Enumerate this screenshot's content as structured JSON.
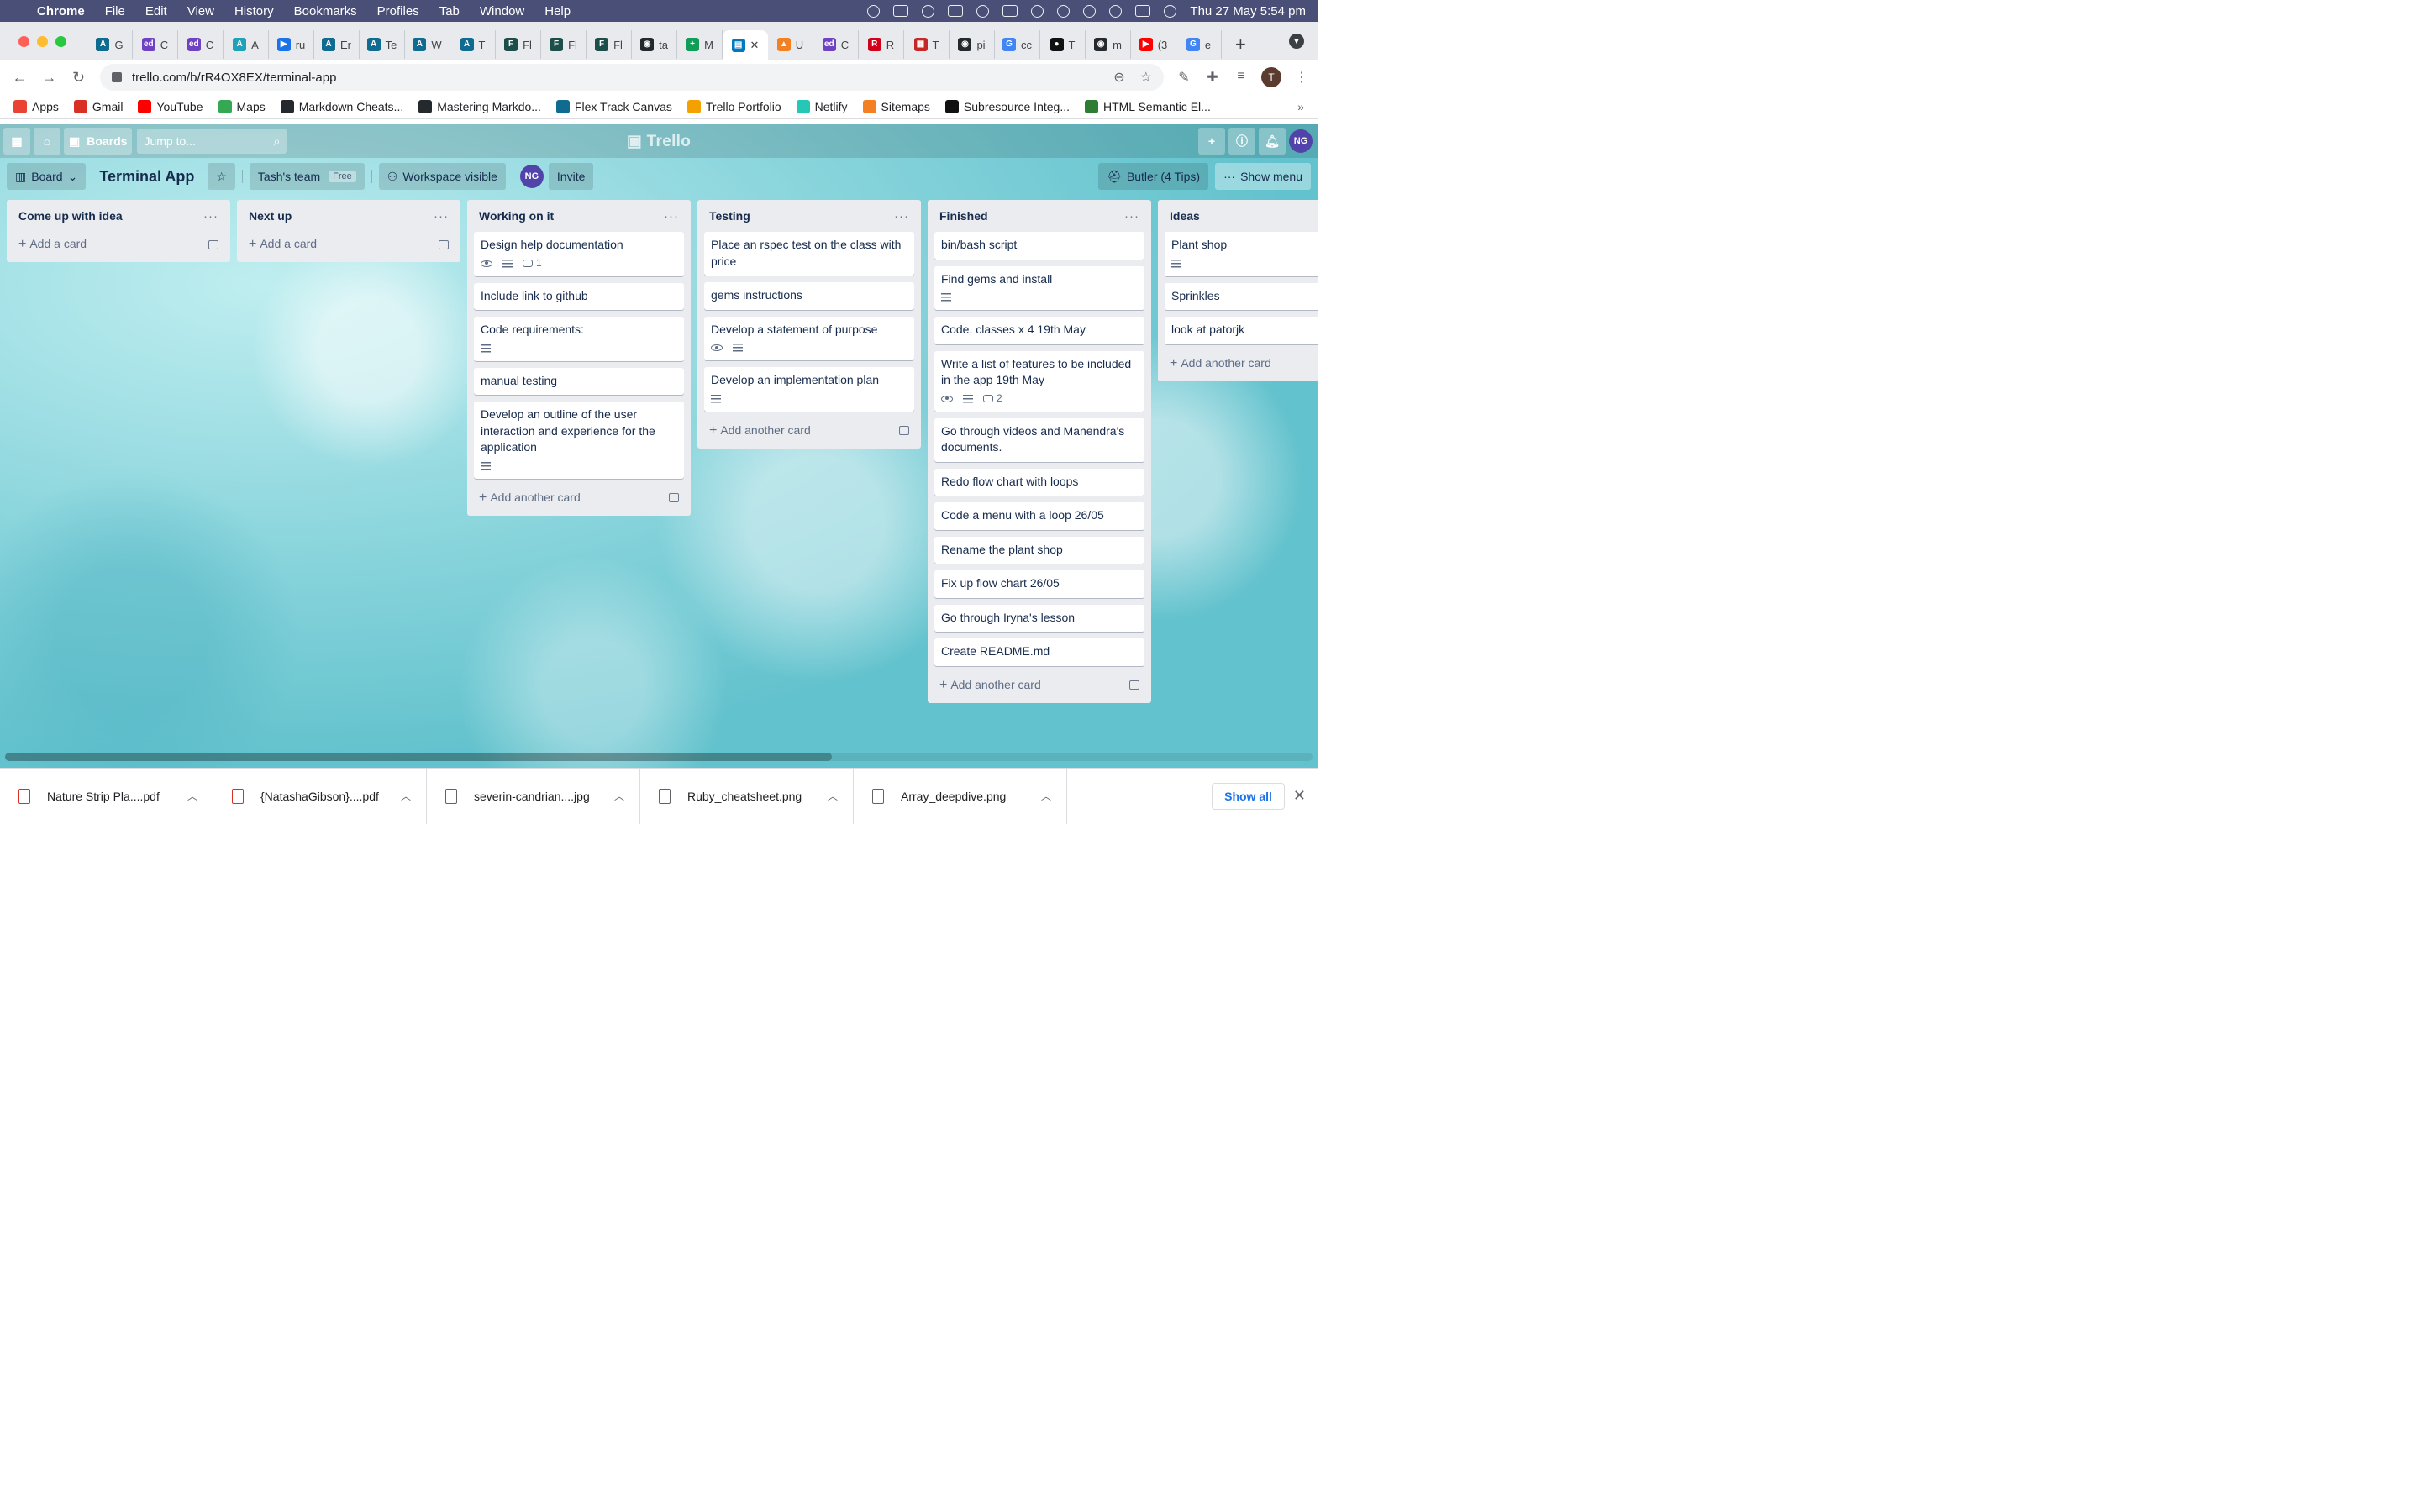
{
  "menubar": {
    "app": "Chrome",
    "items": [
      "File",
      "Edit",
      "View",
      "History",
      "Bookmarks",
      "Profiles",
      "Tab",
      "Window",
      "Help"
    ],
    "clock": "Thu 27 May  5:54 pm"
  },
  "tabs": [
    {
      "fav": "A",
      "label": "G",
      "color": "#0f6b8f"
    },
    {
      "fav": "ed",
      "label": "C",
      "color": "#6f42c1"
    },
    {
      "fav": "ed",
      "label": "C",
      "color": "#6f42c1"
    },
    {
      "fav": "A",
      "label": "A",
      "color": "#21a1b8"
    },
    {
      "fav": "▶",
      "label": "ru",
      "color": "#1a73e8"
    },
    {
      "fav": "A",
      "label": "Er",
      "color": "#0f6b8f"
    },
    {
      "fav": "A",
      "label": "Te",
      "color": "#0f6b8f"
    },
    {
      "fav": "A",
      "label": "W",
      "color": "#0f6b8f"
    },
    {
      "fav": "A",
      "label": "T",
      "color": "#0f6b8f"
    },
    {
      "fav": "F",
      "label": "Fl",
      "color": "#1c4e4a"
    },
    {
      "fav": "F",
      "label": "Fl",
      "color": "#1c4e4a"
    },
    {
      "fav": "F",
      "label": "Fl",
      "color": "#1c4e4a"
    },
    {
      "fav": "◉",
      "label": "ta",
      "color": "#24292e"
    },
    {
      "fav": "+",
      "label": "M",
      "color": "#0f9d58"
    },
    {
      "fav": "▤",
      "label": "",
      "color": "#0079bf",
      "active": true
    },
    {
      "fav": "▲",
      "label": "U",
      "color": "#f48024"
    },
    {
      "fav": "ed",
      "label": "C",
      "color": "#6f42c1"
    },
    {
      "fav": "R",
      "label": "R",
      "color": "#d0021b"
    },
    {
      "fav": "▦",
      "label": "T",
      "color": "#c62828"
    },
    {
      "fav": "◉",
      "label": "pi",
      "color": "#24292e"
    },
    {
      "fav": "G",
      "label": "cc",
      "color": "#4285f4"
    },
    {
      "fav": "●",
      "label": "T",
      "color": "#111111"
    },
    {
      "fav": "◉",
      "label": "m",
      "color": "#24292e"
    },
    {
      "fav": "▶",
      "label": "(3",
      "color": "#ff0000"
    },
    {
      "fav": "G",
      "label": "e",
      "color": "#4285f4"
    }
  ],
  "omnibox": {
    "url": "trello.com/b/rR4OX8EX/terminal-app"
  },
  "bookmarks": [
    {
      "label": "Apps",
      "color": "#ea4335"
    },
    {
      "label": "Gmail",
      "color": "#d93025"
    },
    {
      "label": "YouTube",
      "color": "#ff0000"
    },
    {
      "label": "Maps",
      "color": "#34a853"
    },
    {
      "label": "Markdown Cheats...",
      "color": "#24292e"
    },
    {
      "label": "Mastering Markdo...",
      "color": "#24292e"
    },
    {
      "label": "Flex Track Canvas",
      "color": "#0f6b8f"
    },
    {
      "label": "Trello Portfolio",
      "color": "#f4a100"
    },
    {
      "label": "Netlify",
      "color": "#25c7b7"
    },
    {
      "label": "Sitemaps",
      "color": "#f48024"
    },
    {
      "label": "Subresource Integ...",
      "color": "#111111"
    },
    {
      "label": "HTML Semantic El...",
      "color": "#2e7d32"
    }
  ],
  "trello": {
    "boards_label": "Boards",
    "jump_placeholder": "Jump to...",
    "logo": "Trello",
    "user_initials": "NG"
  },
  "boardbar": {
    "view": "Board",
    "title": "Terminal App",
    "team": "Tash's team",
    "team_plan": "Free",
    "visibility": "Workspace visible",
    "invite": "Invite",
    "butler": "Butler (4 Tips)",
    "show_menu": "Show menu"
  },
  "lists": [
    {
      "title": "Come up with idea",
      "add": "Add a card",
      "cards": []
    },
    {
      "title": "Next up",
      "add": "Add a card",
      "cards": []
    },
    {
      "title": "Working on it",
      "add": "Add another card",
      "cards": [
        {
          "text": "Design help documentation",
          "watch": true,
          "desc": true,
          "comments": "1"
        },
        {
          "text": "Include link to github"
        },
        {
          "text": "Code requirements:",
          "desc": true
        },
        {
          "text": "manual testing"
        },
        {
          "text": "Develop an outline of the user interaction and experience for the application",
          "desc": true
        }
      ]
    },
    {
      "title": "Testing",
      "add": "Add another card",
      "cards": [
        {
          "text": "Place an rspec test on the class with price"
        },
        {
          "text": "gems instructions"
        },
        {
          "text": "Develop a statement of purpose",
          "watch": true,
          "desc": true
        },
        {
          "text": "Develop an implementation plan",
          "desc": true
        }
      ]
    },
    {
      "title": "Finished",
      "add": "Add another card",
      "cards": [
        {
          "text": "bin/bash script"
        },
        {
          "text": "Find gems and install",
          "desc": true
        },
        {
          "text": "Code, classes x 4 19th May"
        },
        {
          "text": "Write a list of features to be included in the app 19th May",
          "watch": true,
          "desc": true,
          "comments": "2"
        },
        {
          "text": "Go through videos and Manendra's documents."
        },
        {
          "text": "Redo flow chart with loops"
        },
        {
          "text": "Code a menu with a loop 26/05"
        },
        {
          "text": "Rename the plant shop"
        },
        {
          "text": "Fix up flow chart 26/05"
        },
        {
          "text": "Go through Iryna's lesson"
        },
        {
          "text": "Create README.md"
        }
      ]
    },
    {
      "title": "Ideas",
      "add": "Add another card",
      "cards": [
        {
          "text": "Plant shop",
          "desc": true
        },
        {
          "text": "Sprinkles"
        },
        {
          "text": "look at patorjk"
        }
      ]
    }
  ],
  "downloads": [
    {
      "name": "Nature Strip  Pla....pdf",
      "kind": "pdf"
    },
    {
      "name": "{NatashaGibson}....pdf",
      "kind": "pdf"
    },
    {
      "name": "severin-candrian....jpg",
      "kind": "img"
    },
    {
      "name": "Ruby_cheatsheet.png",
      "kind": "img"
    },
    {
      "name": "Array_deepdive.png",
      "kind": "img"
    }
  ],
  "show_all": "Show all"
}
